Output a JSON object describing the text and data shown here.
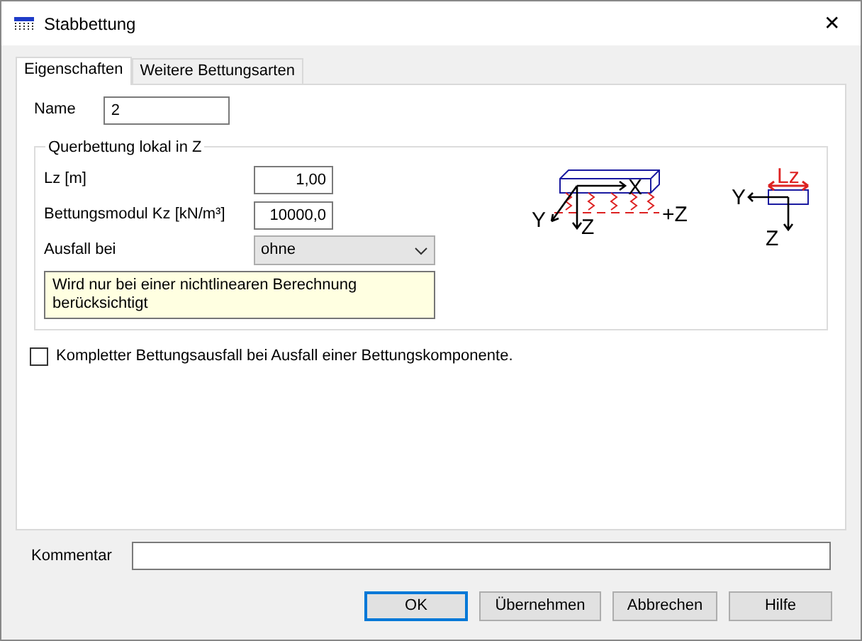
{
  "window": {
    "title": "Stabbettung",
    "close": "✕"
  },
  "tabs": [
    {
      "label": "Eigenschaften",
      "selected": true
    },
    {
      "label": "Weitere Bettungsarten",
      "selected": false
    }
  ],
  "name": {
    "label": "Name",
    "value": "2"
  },
  "group": {
    "title": "Querbettung lokal in Z",
    "fields": [
      {
        "kind": "number",
        "label": "Lz [m]",
        "value": "1,00"
      },
      {
        "kind": "number",
        "label": "Bettungsmodul Kz [kN/m³]",
        "value": "10000,0"
      },
      {
        "kind": "select",
        "label": "Ausfall bei",
        "value": "ohne"
      }
    ],
    "note": "Wird nur bei einer nichtlinearen Berechnung berücksichtigt",
    "beam_labels": [
      "Y",
      "X",
      "Z",
      "+Z"
    ],
    "section_labels": [
      "Lz",
      "Y",
      "Z"
    ]
  },
  "checkbox": {
    "label": "Kompletter Bettungsausfall bei Ausfall einer Bettungskomponente.",
    "checked": false
  },
  "comment": {
    "label": "Kommentar"
  },
  "buttons": [
    {
      "label": "OK",
      "default": true
    },
    {
      "label": "Übernehmen",
      "default": false
    },
    {
      "label": "Abbrechen",
      "default": false
    },
    {
      "label": "Hilfe",
      "default": false
    }
  ]
}
